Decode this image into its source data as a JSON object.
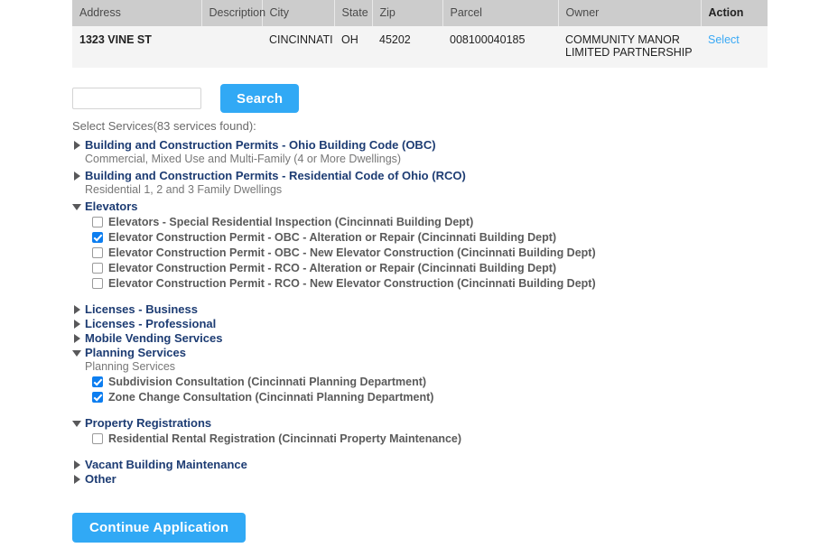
{
  "results_table": {
    "columns": [
      "Address",
      "Description",
      "City",
      "State",
      "Zip",
      "Parcel",
      "Owner",
      "Action"
    ],
    "rows": [
      {
        "address": "1323 VINE ST",
        "description": "",
        "city": "CINCINNATI",
        "state": "OH",
        "zip": "45202",
        "parcel": "008100040185",
        "owner": "COMMUNITY MANOR LIMITED PARTNERSHIP",
        "action_label": "Select"
      }
    ]
  },
  "search": {
    "value": "",
    "placeholder": "",
    "button_label": "Search"
  },
  "services": {
    "caption": "Select Services(83 services found):",
    "groups": [
      {
        "title": "Building and Construction Permits - Ohio Building Code (OBC)",
        "description": "Commercial, Mixed Use and Multi-Family (4 or More Dwellings)",
        "expanded": false,
        "options": []
      },
      {
        "title": "Building and Construction Permits - Residential Code of Ohio (RCO)",
        "description": "Residential 1, 2 and 3 Family Dwellings",
        "expanded": false,
        "options": []
      },
      {
        "title": "Elevators",
        "description": "",
        "expanded": true,
        "options": [
          {
            "label": "Elevators - Special Residential Inspection (Cincinnati Building Dept)",
            "checked": false
          },
          {
            "label": "Elevator Construction Permit - OBC - Alteration or Repair (Cincinnati Building Dept)",
            "checked": true
          },
          {
            "label": "Elevator Construction Permit - OBC - New Elevator Construction (Cincinnati Building Dept)",
            "checked": false
          },
          {
            "label": "Elevator Construction Permit - RCO - Alteration or Repair (Cincinnati Building Dept)",
            "checked": false
          },
          {
            "label": "Elevator Construction Permit - RCO - New Elevator Construction (Cincinnati Building Dept)",
            "checked": false
          }
        ]
      },
      {
        "title": "Licenses - Business",
        "description": "",
        "expanded": false,
        "options": []
      },
      {
        "title": "Licenses - Professional",
        "description": "",
        "expanded": false,
        "options": []
      },
      {
        "title": "Mobile Vending Services",
        "description": "",
        "expanded": false,
        "options": []
      },
      {
        "title": "Planning Services",
        "description": "",
        "sub_label": "Planning Services",
        "expanded": true,
        "options": [
          {
            "label": "Subdivision Consultation (Cincinnati Planning Department)",
            "checked": true
          },
          {
            "label": "Zone Change Consultation (Cincinnati Planning Department)",
            "checked": true
          }
        ]
      },
      {
        "title": "Property Registrations",
        "description": "",
        "expanded": true,
        "options": [
          {
            "label": "Residential Rental Registration (Cincinnati Property Maintenance)",
            "checked": false
          }
        ]
      },
      {
        "title": "Vacant Building Maintenance",
        "description": "",
        "expanded": false,
        "options": []
      },
      {
        "title": "Other",
        "description": "",
        "expanded": false,
        "options": []
      }
    ]
  },
  "footer": {
    "continue_label": "Continue Application"
  },
  "colors": {
    "accent_blue": "#31a9f5",
    "link_blue": "#3aa9f5",
    "heading_navy": "#1d3c73",
    "checkbox_blue": "#0d7ef0",
    "table_header_gray": "#cccccc",
    "table_row_gray": "#f4f4f4"
  }
}
